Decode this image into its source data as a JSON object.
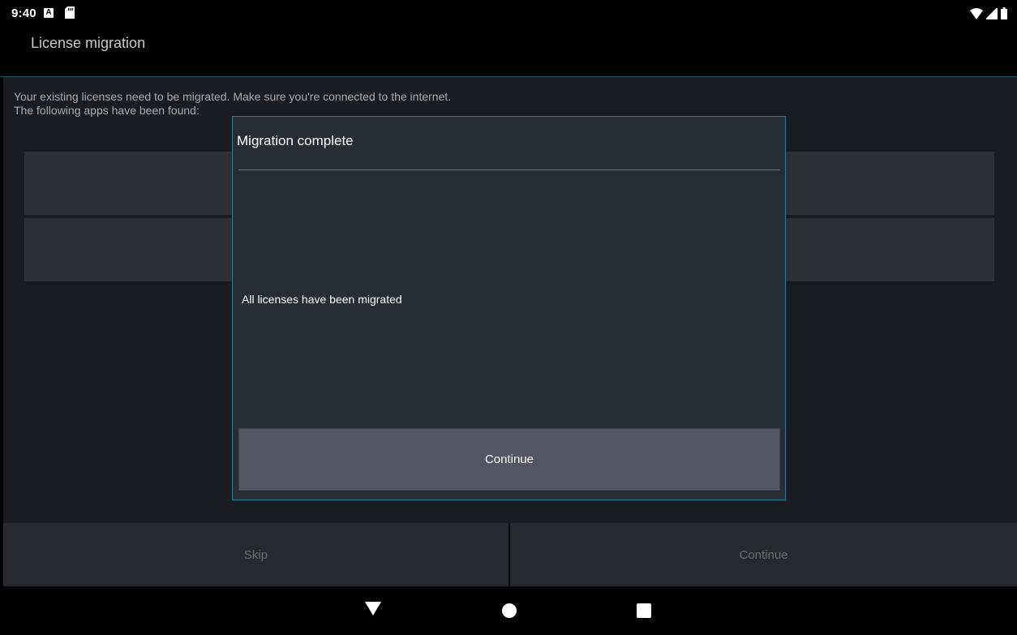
{
  "status_bar": {
    "time": "9:40",
    "notification_icons": [
      "a-icon",
      "sd-card-icon"
    ],
    "system_icons": [
      "wifi-icon",
      "signal-icon",
      "battery-icon"
    ]
  },
  "app_bar": {
    "title": "License migration"
  },
  "content": {
    "description_line1": "Your existing licenses need to be migrated. Make sure you're connected to the internet.",
    "description_line2": "The following apps have been found:"
  },
  "bottom_buttons": {
    "skip": "Skip",
    "continue": "Continue"
  },
  "dialog": {
    "title": "Migration complete",
    "message": "All licenses have been migrated",
    "button": "Continue"
  },
  "colors": {
    "accent": "#2a8ba6",
    "dialog_bg": "#282c35",
    "button_bg": "#535562",
    "content_bg": "#1b1c21"
  },
  "nav_bar": {
    "icons": [
      "back-icon",
      "home-icon",
      "recents-icon"
    ]
  }
}
